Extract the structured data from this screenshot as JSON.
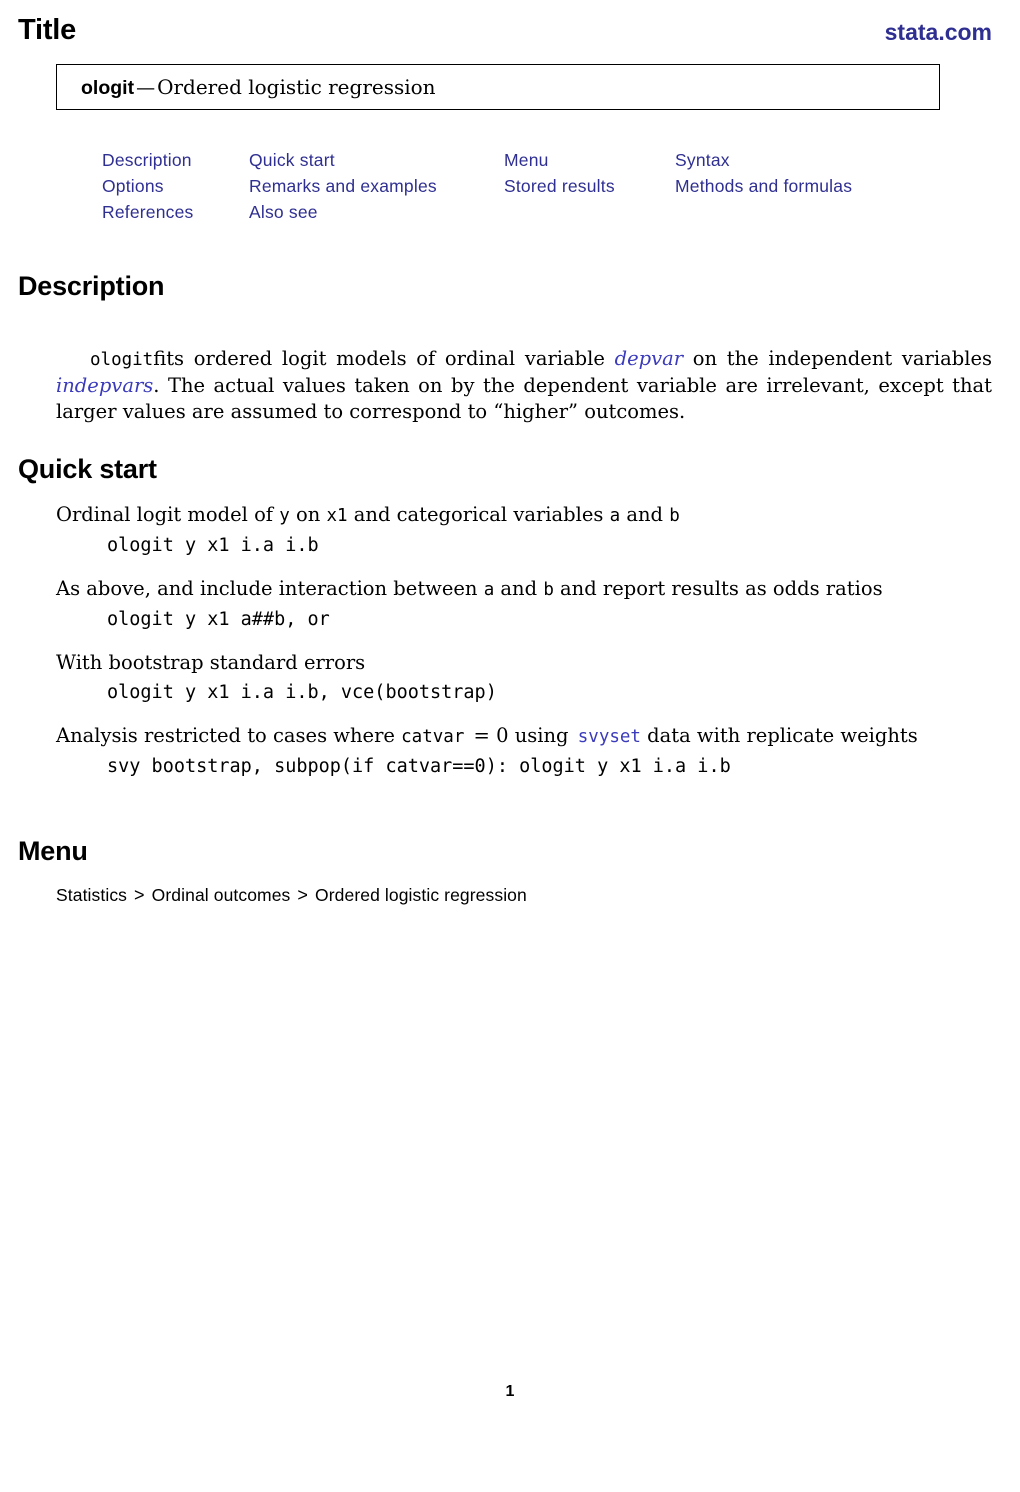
{
  "header": {
    "title": "Title",
    "site_link": "stata.com",
    "link_color": "#2f2f92"
  },
  "title_box": {
    "command": "ologit",
    "dash": "—",
    "description": "Ordered logistic regression"
  },
  "nav_links": {
    "rows": [
      [
        "Description",
        "Quick start",
        "Menu",
        "Syntax"
      ],
      [
        "Options",
        "Remarks and examples",
        "Stored results",
        "Methods and formulas"
      ],
      [
        "References",
        "Also see",
        "",
        ""
      ]
    ]
  },
  "sections": {
    "description": {
      "heading": "Description",
      "para_1": "fits ordered logit models of ordinal variable ",
      "depvar": "depvar",
      "para_2": " on the independent variables ",
      "indepvars": "indepvars",
      "para_3": ". The actual values taken on by the dependent variable are irrelevant, except that larger values are assumed to correspond to “higher” outcomes.",
      "cmd": "ologit"
    },
    "quick_start": {
      "heading": "Quick start",
      "items": [
        {
          "desc_1": "Ordinal logit model of ",
          "m1": "y",
          "desc_2": " on ",
          "m2": "x1",
          "desc_3": " and categorical variables ",
          "m3": "a",
          "desc_4": " and ",
          "m4": "b",
          "desc_5": "",
          "code": "ologit y x1 i.a i.b"
        },
        {
          "desc_1": "As above, and include interaction between ",
          "m1": "a",
          "desc_2": " and ",
          "m2": "b",
          "desc_3": " and report results as odds ratios",
          "m3": "",
          "desc_4": "",
          "m4": "",
          "desc_5": "",
          "code": "ologit y x1 a##b, or"
        },
        {
          "desc_1": "With bootstrap standard errors",
          "m1": "",
          "desc_2": "",
          "m2": "",
          "desc_3": "",
          "m3": "",
          "desc_4": "",
          "m4": "",
          "desc_5": "",
          "code": "ologit y x1 i.a i.b, vce(bootstrap)"
        },
        {
          "desc_1": "Analysis restricted to cases where ",
          "m1": "catvar",
          "desc_2": " = 0 using ",
          "m2": "svyset",
          "desc_3": " data with replicate weights",
          "m3": "",
          "desc_4": "",
          "m4": "",
          "desc_5": "",
          "code": "svy bootstrap, subpop(if catvar==0): ologit y x1 i.a i.b"
        }
      ]
    },
    "menu": {
      "heading": "Menu",
      "path": [
        "Statistics",
        "Ordinal outcomes",
        "Ordered logistic regression"
      ],
      "separator": ">"
    }
  },
  "footer": {
    "page_number": "1"
  }
}
